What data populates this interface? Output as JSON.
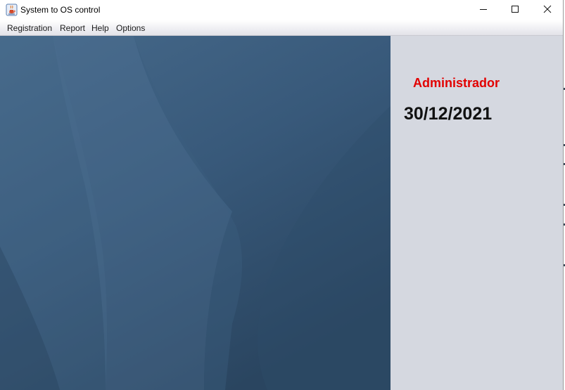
{
  "window": {
    "title": "System to OS control",
    "app_icon": "java-cup-icon",
    "controls": [
      "minimize-icon",
      "maximize-icon",
      "close-icon"
    ]
  },
  "menu": {
    "items": [
      "Registration",
      "Report",
      "Help",
      "Options"
    ]
  },
  "side_panel": {
    "user": "Administrador",
    "date": "30/12/2021"
  },
  "colors": {
    "background_blue": "#3a5a78",
    "side_panel": "#d5d8e0",
    "user_text": "#e20000",
    "date_text": "#111111"
  }
}
